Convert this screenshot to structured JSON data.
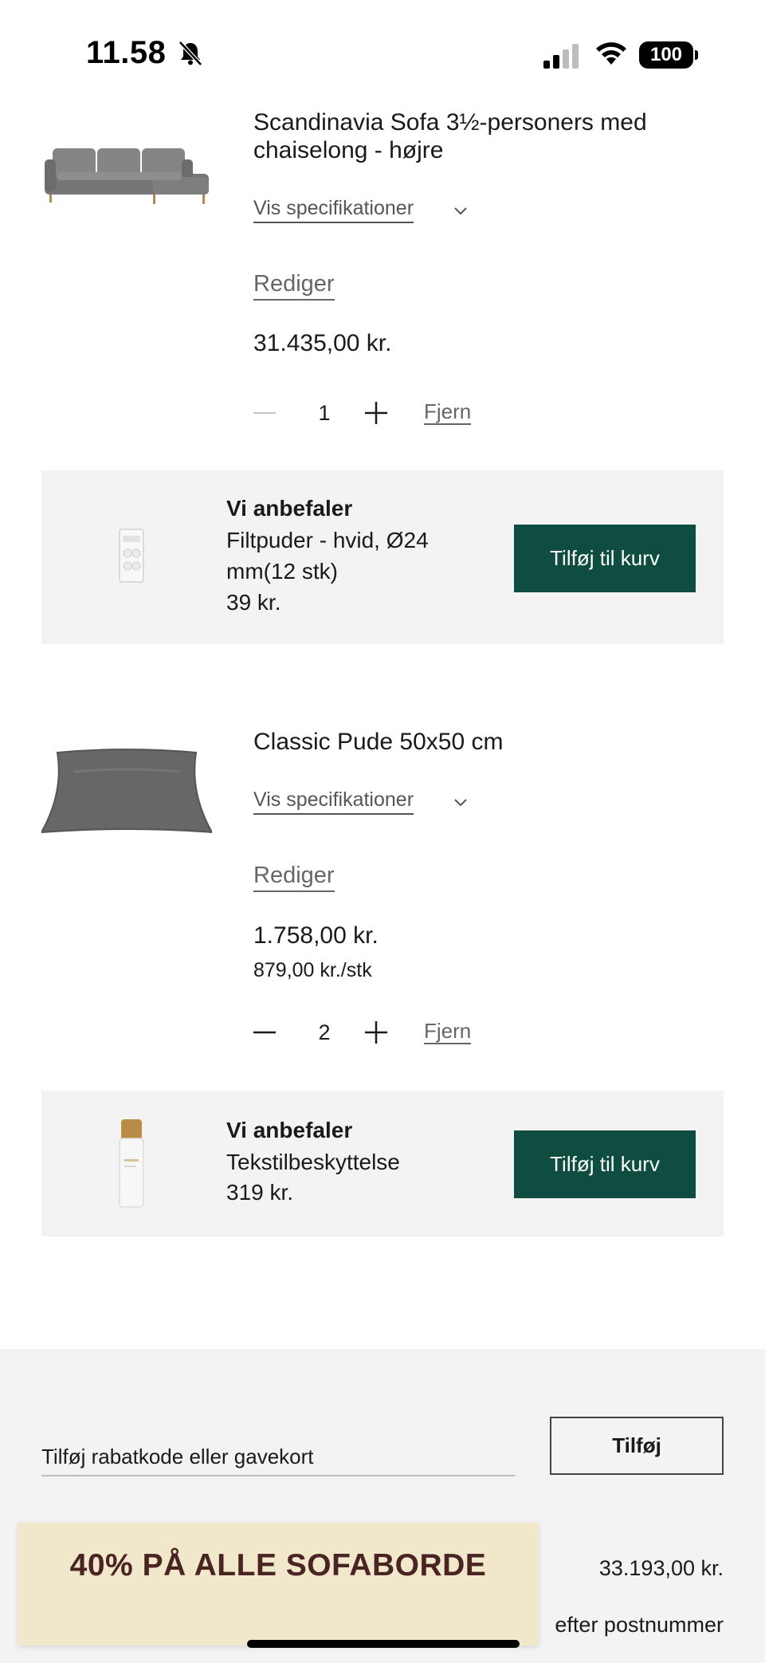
{
  "status_bar": {
    "time": "11.58",
    "battery": "100",
    "icons": [
      "bell-slash-icon",
      "signal-icon",
      "wifi-icon",
      "battery-icon"
    ]
  },
  "cart_items": [
    {
      "name": "Scandinavia Sofa 3½-personers med chaiselong - højre",
      "spec_label": "Vis specifikationer",
      "edit_label": "Rediger",
      "price": "31.435,00 kr.",
      "unit_price": "",
      "quantity": "1",
      "remove_label": "Fjern",
      "image": "sofa-image"
    },
    {
      "name": "Classic Pude 50x50 cm",
      "spec_label": "Vis specifikationer",
      "edit_label": "Rediger",
      "price": "1.758,00 kr.",
      "unit_price": "879,00 kr./stk",
      "quantity": "2",
      "remove_label": "Fjern",
      "image": "pillow-image"
    }
  ],
  "recommendations": [
    {
      "title": "Vi anbefaler",
      "name": "Filtpuder - hvid, Ø24 mm(12 stk)",
      "price": "39 kr.",
      "button": "Tilføj til kurv",
      "image": "felt-pads-image"
    },
    {
      "title": "Vi anbefaler",
      "name": "Tekstilbeskyttelse",
      "price": "319 kr.",
      "button": "Tilføj til kurv",
      "image": "spray-bottle-image"
    }
  ],
  "summary": {
    "discount_placeholder": "Tilføj rabatkode eller gavekort",
    "apply_label": "Tilføj",
    "subtotal": "33.193,00 kr.",
    "shipping_text": "efter postnummer"
  },
  "promo": {
    "text": "40% PÅ ALLE SOFABORDE"
  },
  "colors": {
    "accent": "#0e4d40",
    "panel": "#f3f3f3",
    "promo_bg": "#f1e8cc",
    "promo_text": "#4a2323"
  }
}
